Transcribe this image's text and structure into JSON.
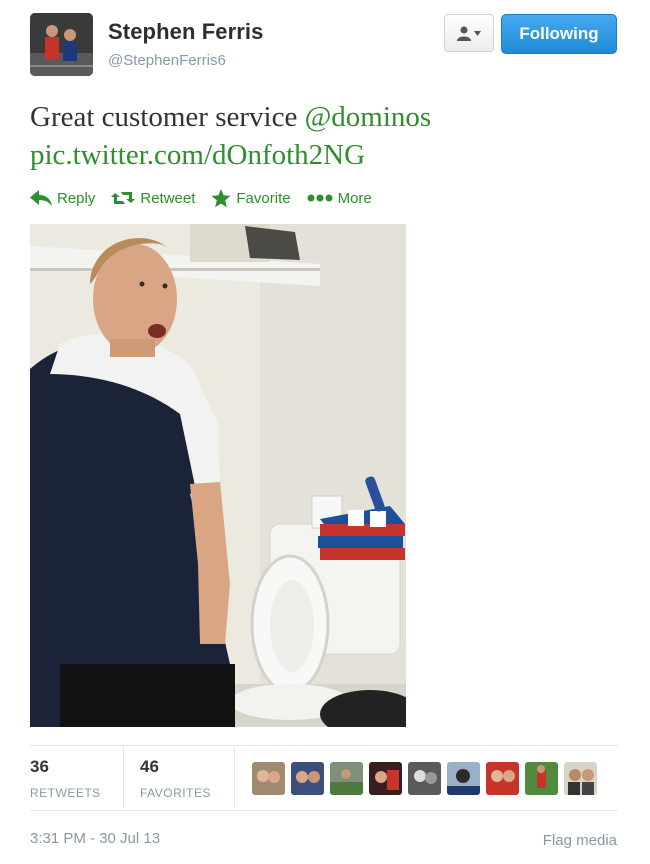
{
  "user": {
    "name": "Stephen Ferris",
    "handle": "@StephenFerris6"
  },
  "header_buttons": {
    "follow_state": "Following"
  },
  "tweet": {
    "text_plain": "Great customer service ",
    "mention": "@dominos",
    "pic_link": "pic.twitter.com/dOnfoth2NG"
  },
  "actions": [
    {
      "label": "Reply",
      "icon": "reply-icon"
    },
    {
      "label": "Retweet",
      "icon": "retweet-icon"
    },
    {
      "label": "Favorite",
      "icon": "star-icon"
    },
    {
      "label": "More",
      "icon": "more-dots-icon"
    }
  ],
  "stats": {
    "retweets_count": "36",
    "retweets_label": "RETWEETS",
    "favorites_count": "46",
    "favorites_label": "FAVORITES"
  },
  "footer": {
    "timestamp": "3:31 PM - 30 Jul 13",
    "flag_label": "Flag media"
  },
  "colors": {
    "link_green": "#2d8f2d",
    "follow_blue": "#1e8ad6",
    "muted": "#8899a6"
  }
}
